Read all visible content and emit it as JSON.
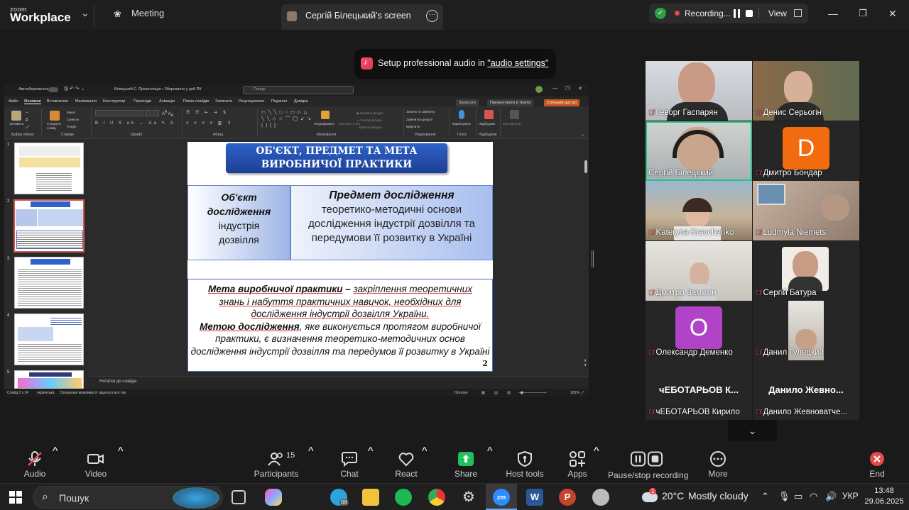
{
  "topbar": {
    "logo_small": "zoom",
    "logo_big": "Workplace",
    "tab_meeting": "Meeting",
    "tab_screen": "Сергій Білецький's screen",
    "recording": "Recording...",
    "view": "View"
  },
  "notification": {
    "prefix": "Setup professional audio in ",
    "link": "\"audio settings\""
  },
  "ppt": {
    "autosave": "Автозбереження",
    "filename": "Білецький С. Презентація  •  Збережено у цей ПК",
    "search": "Пошук",
    "menu": [
      "Файл",
      "Основне",
      "Вставлення",
      "Малювання",
      "Конструктор",
      "Переходи",
      "Анімація",
      "Показ слайдів",
      "Записати",
      "Рецензування",
      "Подання",
      "Довідка"
    ],
    "btn_record": "Записати",
    "btn_present": "Презентувати в Teams",
    "btn_share": "Спільний доступ",
    "ribbon_groups": [
      "Буфер обміну",
      "Слайди",
      "Шрифт",
      "Абзац",
      "Малювання",
      "Редагування",
      "Голос",
      "Надбудови"
    ],
    "ribbon_items": {
      "paste": "Вставити",
      "new_slide": "Створити слайд",
      "reuse": "Макет",
      "reset": "Скинути",
      "section": "Розділ",
      "arrange": "Упорядкувати",
      "quick_styles": "Експрес-стилі",
      "find": "Знайти та замінити",
      "replace": "Замінити шрифти",
      "select": "Виділити",
      "dictate": "Надиктувати",
      "addins": "Надбудови",
      "designer": "Конструктор"
    },
    "notes_placeholder": "Нотатки до слайда",
    "status_left": "Слайд 2 з 14",
    "status_lang": "українська",
    "status_access": "Спеціальні можливості: вдалося все так",
    "status_notes": "Нотатки",
    "status_zoom": "105%",
    "thumb_numbers": [
      "1",
      "2",
      "3",
      "4",
      "5"
    ]
  },
  "slide": {
    "title_line1": "ОБ'ЄКТ, ПРЕДМЕТ ТА МЕТА",
    "title_line2": "ВИРОБНИЧОЇ ПРАКТИКИ",
    "object_line1": "Об'єкт",
    "object_line2": "дослідження",
    "object_line3": "індустрія",
    "object_line4": "дозвілля",
    "subject_heading": "Предмет дослідження",
    "subject_body": "теоретико-методичні основи дослідження індустрії дозвілля та передумови її розвитку в Україні",
    "goal_label": "Мета виробничої практики",
    "goal_dash": " – ",
    "goal_text": "закріплення теоретичних знань і набуття практичних навичок, необхідних для дослідження індустрії дозвілля України.",
    "aim_label": "Метою дослідження",
    "aim_text": ", яке виконується протягом виробничої практики, є визначення теоретико-методичних основ дослідження індустрії дозвілля та передумов її розвитку в Україні",
    "page_number": "2"
  },
  "participants": [
    {
      "name": "Геворг Гаспарян"
    },
    {
      "name": "Денис Серьогін"
    },
    {
      "name": "Сергій Білецький"
    },
    {
      "name": "Дмитро Бондар",
      "initial": "D",
      "color": "#f26b0f"
    },
    {
      "name": "Kateryna Kravchenko"
    },
    {
      "name": "Ludmyla Niemets"
    },
    {
      "name": "Дмитро Замятін"
    },
    {
      "name": "Сергій Батура"
    },
    {
      "name": "Олександр Деменко",
      "initial": "О",
      "color": "#b043c7"
    },
    {
      "name": "Данил Гулецкий"
    },
    {
      "name": "чЕБОТАРЬОВ Кирило",
      "display": "чЕБОТАРЬОВ К..."
    },
    {
      "name": "Данило Жевноватче...",
      "display": "Данило Жевно..."
    }
  ],
  "toolbar": {
    "audio": "Audio",
    "video": "Video",
    "participants": "Participants",
    "participants_count": "15",
    "chat": "Chat",
    "react": "React",
    "share": "Share",
    "host_tools": "Host tools",
    "apps": "Apps",
    "pause_stop": "Pause/stop recording",
    "more": "More",
    "end": "End"
  },
  "taskbar": {
    "search": "Пошук",
    "telegram_badge": "68",
    "ppt_badge": "1",
    "weather_temp": "20°C",
    "weather_text": "Mostly cloudy",
    "lang": "УКР",
    "time": "13:48",
    "date": "29.06.2025"
  }
}
